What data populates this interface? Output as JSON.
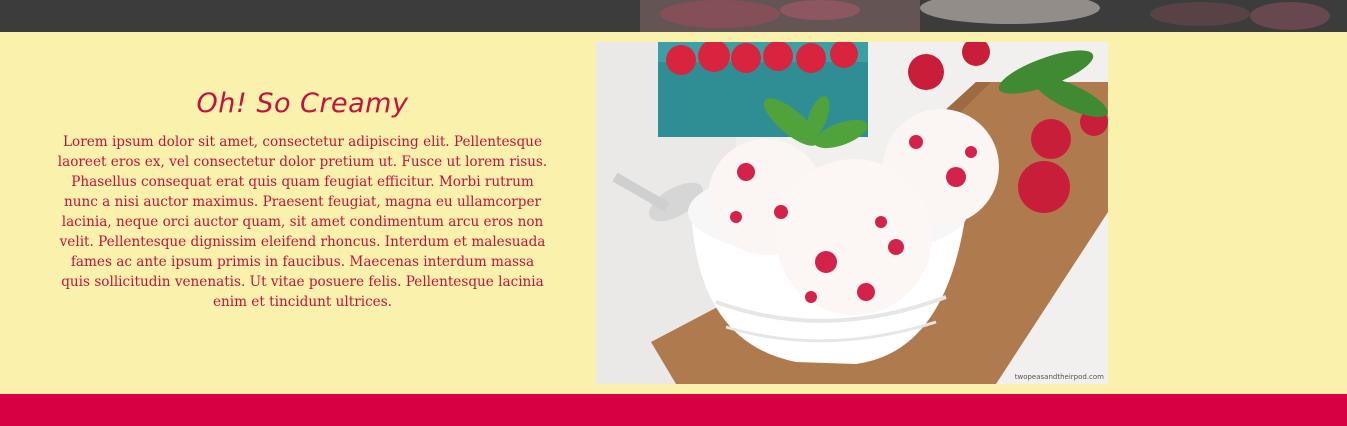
{
  "feature": {
    "title": "Oh! So Creamy",
    "body": "Lorem ipsum dolor sit amet, consectetur adipiscing elit. Pellentesque laoreet eros ex, vel consectetur dolor pretium ut. Fusce ut lorem risus. Phasellus consequat erat quis quam feugiat efficitur. Morbi rutrum nunc a nisi auctor maximus. Praesent feugiat, magna eu ullamcorper lacinia, neque orci auctor quam, sit amet condimentum arcu eros non velit. Pellentesque dignissim eleifend rhoncus. Interdum et malesuada fames ac ante ipsum primis in faucibus. Maecenas interdum massa quis sollicitudin venenatis. Ut vitae posuere felis. Pellentesque lacinia enim et tincidunt ultrices."
  },
  "photo": {
    "credit": "twopeasandtheirpod.com"
  },
  "colors": {
    "background": "#faf1ad",
    "accent": "#c2123f",
    "footer": "#d70042"
  }
}
